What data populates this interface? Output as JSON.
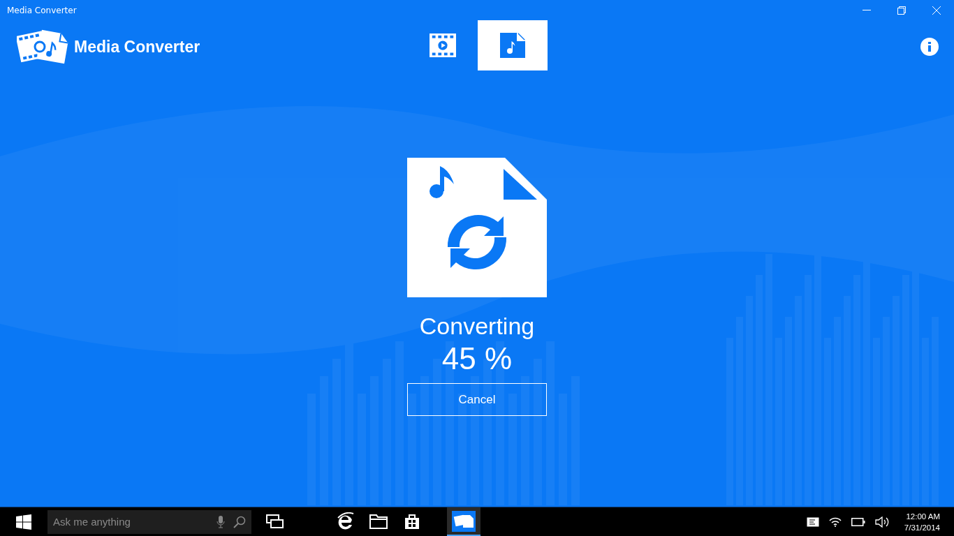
{
  "window": {
    "title": "Media Converter"
  },
  "app": {
    "name": "Media Converter"
  },
  "tabs": [
    {
      "kind": "video",
      "selected": false
    },
    {
      "kind": "audio",
      "selected": true
    }
  ],
  "progress": {
    "label": "Converting",
    "percent": "45 %"
  },
  "cancel_button": "Cancel",
  "taskbar": {
    "search_placeholder": "Ask me anything",
    "apps": [
      {
        "kind": "taskview",
        "selected": false
      },
      {
        "kind": "browser",
        "selected": false
      },
      {
        "kind": "folder",
        "selected": false
      },
      {
        "kind": "store",
        "selected": false
      },
      {
        "kind": "converter",
        "selected": true
      }
    ],
    "time": "12:00 AM",
    "date": "7/31/2014"
  }
}
